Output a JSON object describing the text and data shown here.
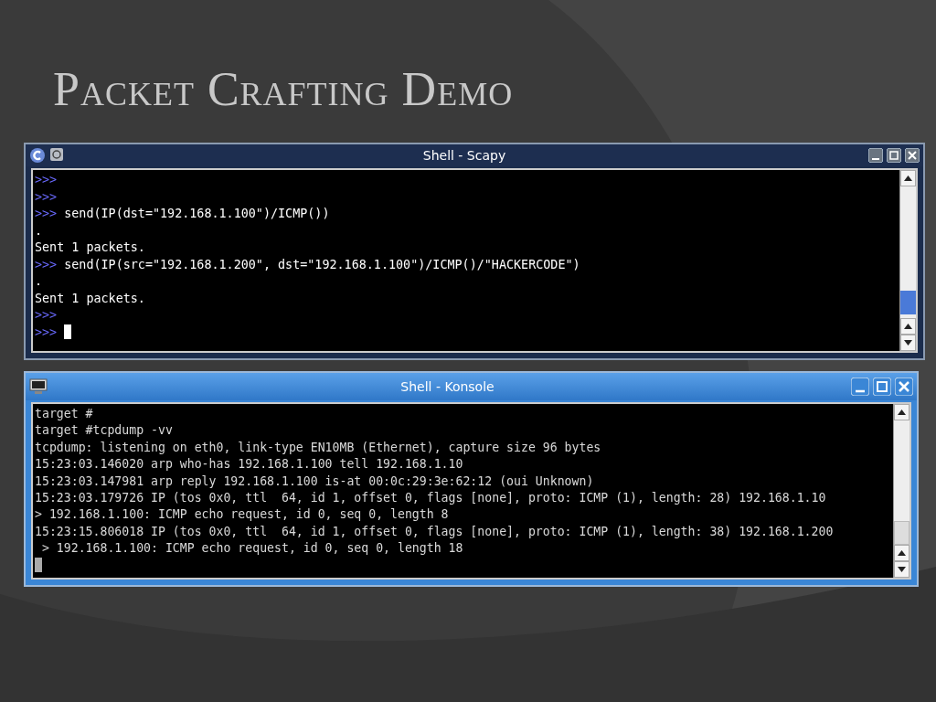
{
  "slide": {
    "title": "Packet Crafting Demo"
  },
  "windows": [
    {
      "kind": "scapy",
      "title": "Shell - Scapy",
      "cursor": true,
      "lines": [
        {
          "prompt": ">>>"
        },
        {
          "prompt": ">>>"
        },
        {
          "prompt": ">>>",
          "text": "send(IP(dst=\"192.168.1.100\")/ICMP())"
        },
        {
          "text": "."
        },
        {
          "text": "Sent 1 packets."
        },
        {
          "prompt": ">>>",
          "text": "send(IP(src=\"192.168.1.200\", dst=\"192.168.1.100\")/ICMP()/\"HACKERCODE\")"
        },
        {
          "text": "."
        },
        {
          "text": "Sent 1 packets."
        },
        {
          "prompt": ">>>"
        },
        {
          "prompt": ">>>"
        }
      ]
    },
    {
      "kind": "konsole",
      "title": "Shell - Konsole",
      "cursor": true,
      "lines": [
        {
          "text": "target #"
        },
        {
          "text": "target #tcpdump -vv"
        },
        {
          "text": "tcpdump: listening on eth0, link-type EN10MB (Ethernet), capture size 96 bytes"
        },
        {
          "text": "15:23:03.146020 arp who-has 192.168.1.100 tell 192.168.1.10"
        },
        {
          "text": "15:23:03.147981 arp reply 192.168.1.100 is-at 00:0c:29:3e:62:12 (oui Unknown)"
        },
        {
          "text": "15:23:03.179726 IP (tos 0x0, ttl  64, id 1, offset 0, flags [none], proto: ICMP (1), length: 28) 192.168.1.10"
        },
        {
          "text": "> 192.168.1.100: ICMP echo request, id 0, seq 0, length 8"
        },
        {
          "text": "15:23:15.806018 IP (tos 0x0, ttl  64, id 1, offset 0, flags [none], proto: ICMP (1), length: 38) 192.168.1.200"
        },
        {
          "text": " > 192.168.1.100: ICMP echo request, id 0, seq 0, length 18"
        }
      ]
    }
  ]
}
